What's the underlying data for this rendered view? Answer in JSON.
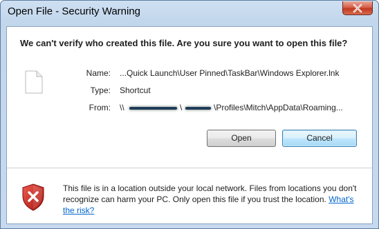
{
  "window": {
    "title": "Open File - Security Warning"
  },
  "question": "We can't verify who created this file. Are you sure you want to open this file?",
  "fields": {
    "name_label": "Name:",
    "name_value": "...Quick Launch\\User Pinned\\TaskBar\\Windows Explorer.lnk",
    "type_label": "Type:",
    "type_value": "Shortcut",
    "from_label": "From:",
    "from_prefix": "\\\\",
    "from_mid": "\\",
    "from_suffix": "\\Profiles\\Mitch\\AppData\\Roaming..."
  },
  "buttons": {
    "open_label": "Open",
    "cancel_label": "Cancel"
  },
  "warning": {
    "text": "This file is in a location outside your local network. Files from locations you don't recognize can harm your PC. Only open this file if you trust the location.",
    "link_label": "What's the risk?"
  },
  "icons": {
    "file": "blank-file-icon",
    "shield": "security-shield-x-icon",
    "close": "close-x-icon"
  },
  "colors": {
    "link": "#0066cc",
    "close_button": "#c0391f",
    "shield_red": "#c8211b"
  }
}
